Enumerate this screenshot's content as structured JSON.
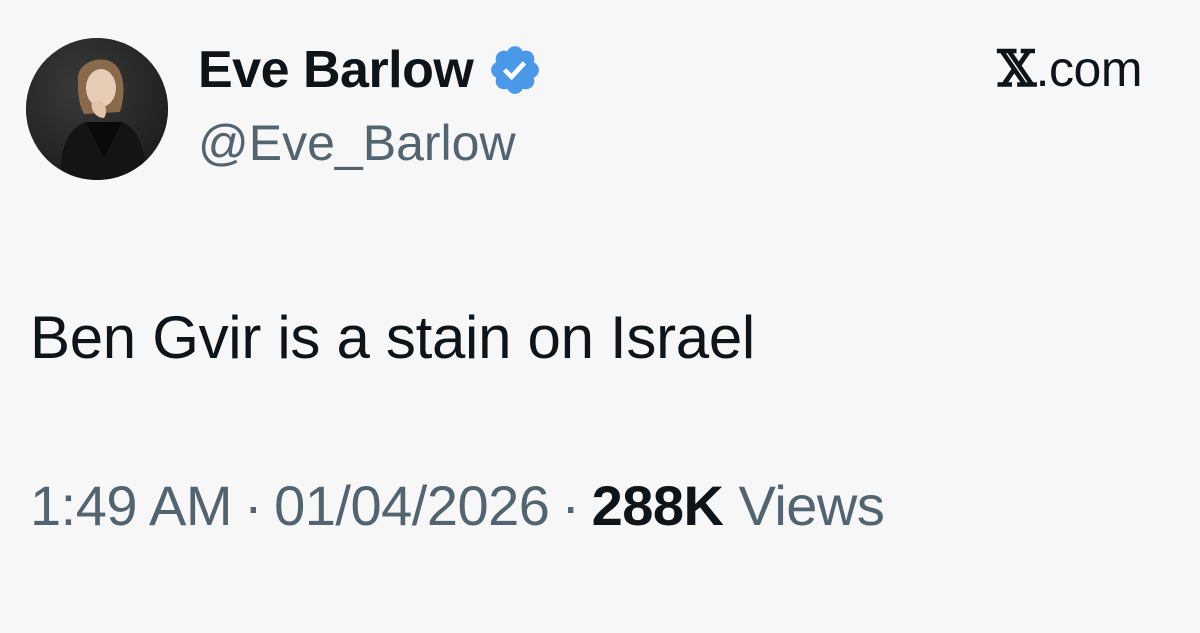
{
  "author": {
    "display_name": "Eve Barlow",
    "handle": "@Eve_Barlow",
    "verified": true,
    "verified_icon": "verified-badge-icon",
    "verified_color": "#4a99e9",
    "avatar_icon": "profile-photo"
  },
  "site": {
    "glyph": "𝕏",
    "suffix": ".com"
  },
  "tweet": {
    "text": "Ben Gvir is a stain on Israel"
  },
  "meta": {
    "time": "1:49 AM",
    "separator": "·",
    "date": "01/04/2026",
    "views_count": "288K",
    "views_label": "Views"
  },
  "colors": {
    "primary_text": "#0f1419",
    "secondary_text": "#536471",
    "background": "#f7f7f8"
  }
}
